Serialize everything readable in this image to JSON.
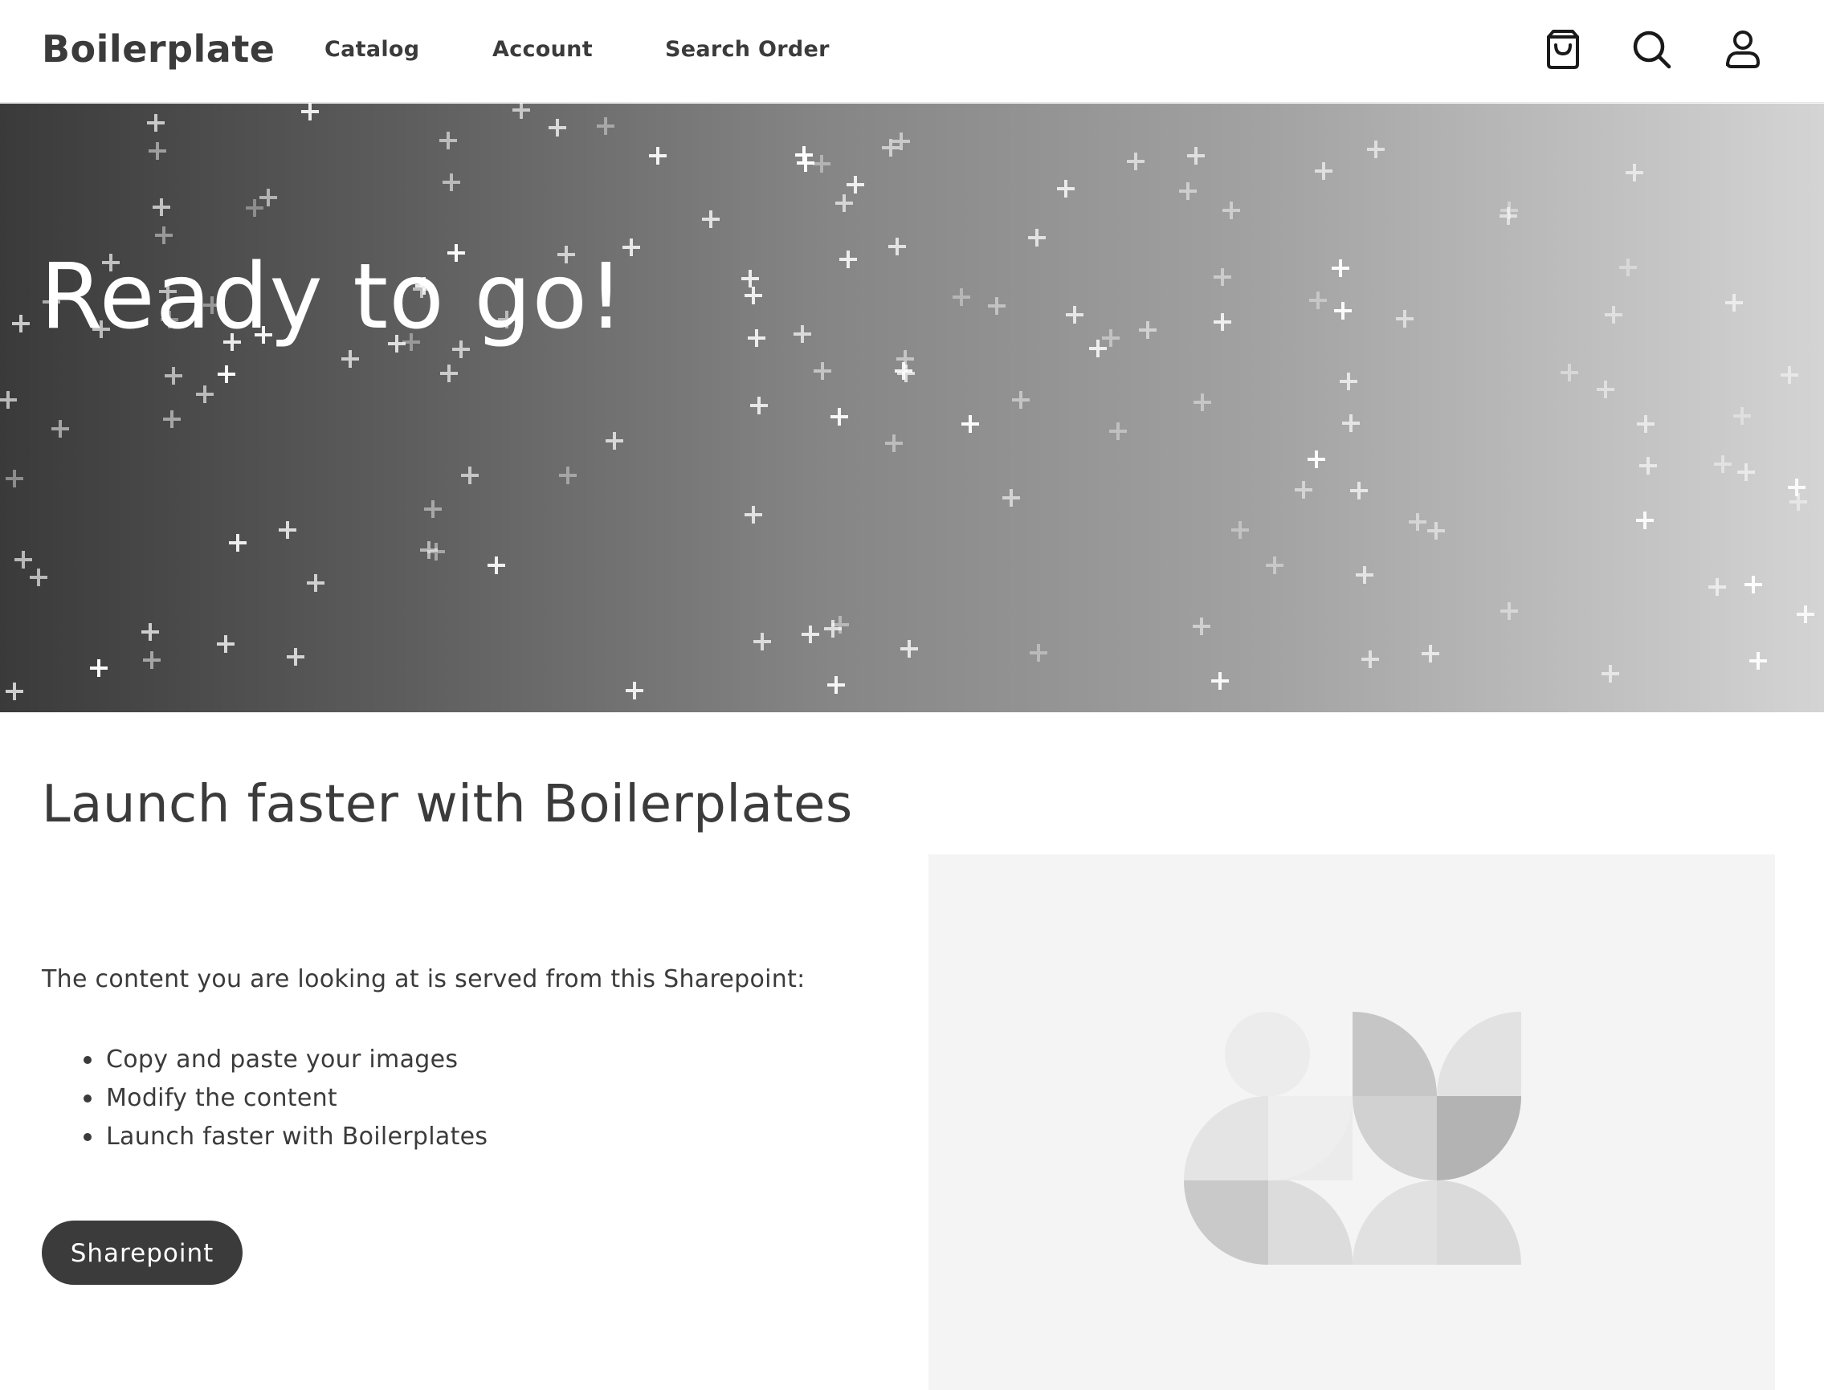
{
  "header": {
    "brand": "Boilerplate",
    "nav": {
      "catalog": "Catalog",
      "account": "Account",
      "search_order": "Search Order"
    },
    "icons": [
      "cart-icon",
      "search-icon",
      "user-icon"
    ]
  },
  "hero": {
    "title": "Ready to go!"
  },
  "content": {
    "title": "Launch faster with Boilerplates",
    "intro": "The content you are looking at is served from this Sharepoint:",
    "bullets": [
      "Copy and paste your images",
      "Modify the content",
      "Launch faster with Boilerplates"
    ],
    "button_label": "Sharepoint"
  },
  "colors": {
    "text": "#3b3b3b",
    "button_bg": "#3b3b3b",
    "button_text": "#ffffff",
    "panel_bg": "#f4f4f4"
  }
}
